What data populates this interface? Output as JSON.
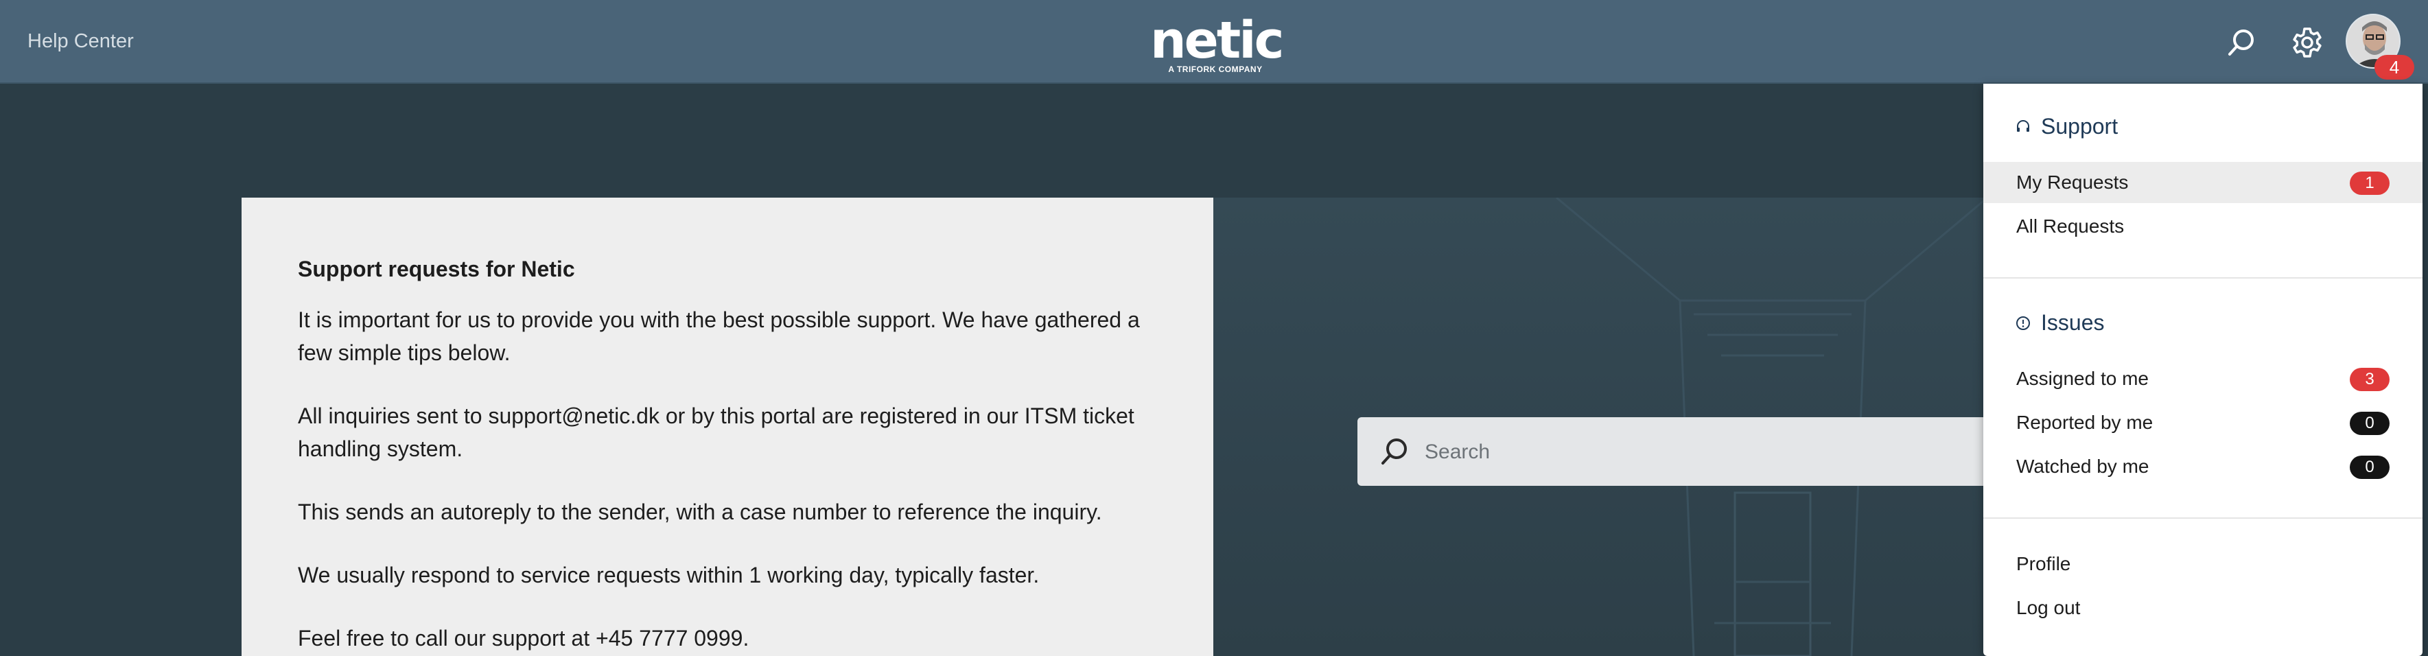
{
  "header": {
    "help_center": "Help Center",
    "logo_main": "netic",
    "logo_sub": "A TRIFORK COMPANY",
    "avatar_badge": "4"
  },
  "card": {
    "title": "Support requests for Netic",
    "paragraphs": [
      "It is important for us to provide you with the best possible support. We have gathered a few simple tips below.",
      "All inquiries sent to support@netic.dk or by this portal are registered in our ITSM ticket handling system.",
      "This sends an autoreply to the sender, with a case number to reference the inquiry.",
      "We usually respond to service requests within 1 working day, typically faster.",
      "Feel free to call our support at +45 7777 0999."
    ]
  },
  "search": {
    "placeholder": "Search"
  },
  "dropdown": {
    "support_heading": "Support",
    "my_requests": {
      "label": "My Requests",
      "count": "1"
    },
    "all_requests": {
      "label": "All Requests"
    },
    "issues_heading": "Issues",
    "assigned": {
      "label": "Assigned to me",
      "count": "3"
    },
    "reported": {
      "label": "Reported by me",
      "count": "0"
    },
    "watched": {
      "label": "Watched by me",
      "count": "0"
    },
    "profile": "Profile",
    "logout": "Log out"
  },
  "colors": {
    "header_bg": "#4a6478",
    "page_bg": "#2b3d46",
    "badge_red": "#e03a3a",
    "badge_black": "#141414",
    "heading_blue": "#1f3a57"
  },
  "icons": [
    "search-icon",
    "gear-icon",
    "headset-icon",
    "info-circle-icon"
  ]
}
